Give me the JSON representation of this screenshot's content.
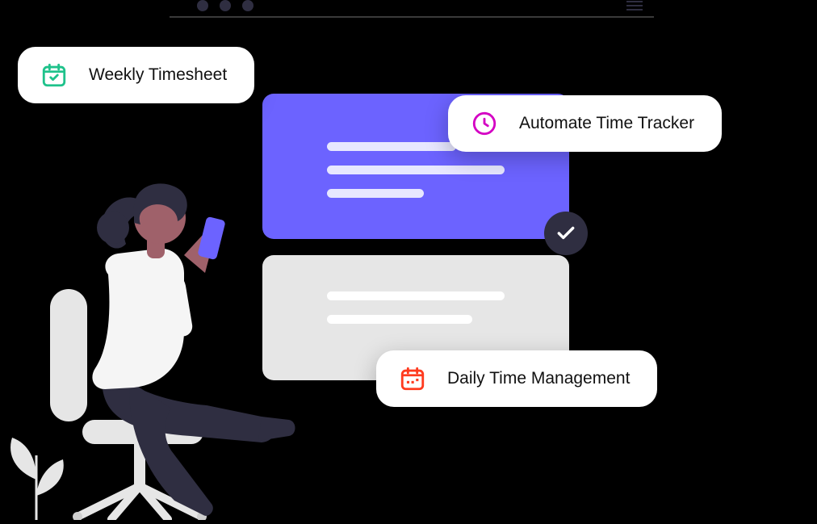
{
  "pills": {
    "weekly": {
      "label": "Weekly Timesheet"
    },
    "automate": {
      "label": "Automate Time Tracker"
    },
    "daily": {
      "label": "Daily Time Management"
    }
  },
  "icons": {
    "calendar_check": "calendar-check-icon",
    "clock": "clock-icon",
    "calendar_dots": "calendar-dots-icon",
    "check": "check-icon",
    "hamburger": "hamburger-menu-icon"
  },
  "colors": {
    "purple": "#6c63ff",
    "green": "#1fc28b",
    "magenta": "#d400c3",
    "orange": "#ff3b1f",
    "dark": "#2f2e41"
  }
}
